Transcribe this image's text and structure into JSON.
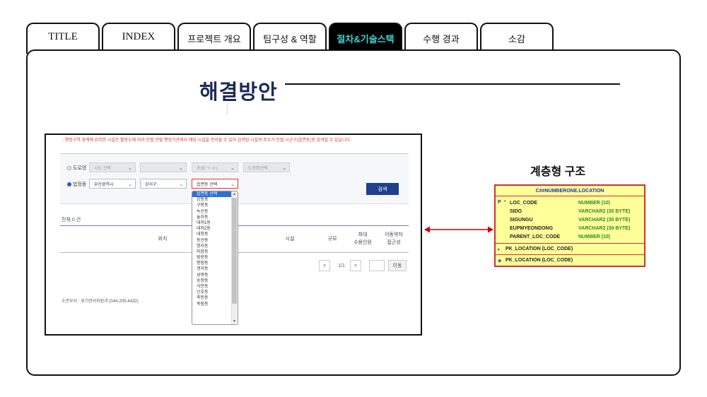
{
  "tabs": [
    {
      "label": "TITLE"
    },
    {
      "label": "INDEX"
    },
    {
      "label": "프로젝트 개요"
    },
    {
      "label": "팀구성 & 역할"
    },
    {
      "label": "절차&기술스택"
    },
    {
      "label": "수행 경과"
    },
    {
      "label": "소감"
    }
  ],
  "section": {
    "heading": "해결방안"
  },
  "screenshot": {
    "notice": "- 행정구역 경계에 위치한 시설은 활용도에 따라 인접 관할 행정기관에서 해당 시설을 관리할 수 있어 검색된 시설의 주소가 인접 시군구(읍면동)로 검색될 수 있습니다.",
    "radio_road": "도로명",
    "radio_legal": "법정동",
    "sel_sido": "시도 선택",
    "sel_sigungu": "",
    "sel_initial": "초성(ㄱ~ㅎ)",
    "sel_roadname": "도로명선택",
    "sel_busan": "부산광역시",
    "sel_gangseo": "강서구",
    "sel_eupmyeondong": "읍면동 선택",
    "search_button": "검색",
    "total_label": "전체",
    "total_count": "0",
    "total_unit": "건",
    "col_location": "위치",
    "col_facility": "시설",
    "col_scale": "규모",
    "col_max_line1": "최대",
    "col_max_line2": "수용인원",
    "col_access_line1": "이동약자",
    "col_access_line2": "접근성",
    "pager_prev": "<",
    "pager_info": "1/1",
    "pager_next": ">",
    "pager_go": "이동",
    "footer": "소관부서 : 위기관리지원과 (044-205-4432)",
    "dropdown_items": [
      "읍면동 선택",
      "강동동",
      "구랑동",
      "녹산동",
      "눌차동",
      "대저1동",
      "대저2동",
      "대항동",
      "동선동",
      "명지동",
      "미음동",
      "범방동",
      "봉림동",
      "생곡동",
      "성북동",
      "송정동",
      "식만동",
      "신호동",
      "죽동동",
      "죽림동"
    ]
  },
  "hierarchy": {
    "title": "계층형 구조",
    "table_name": "C##NUMBERONE.LOCATION",
    "pk_marker": "P",
    "pk_star": "*",
    "columns": [
      {
        "name": "LOC_CODE",
        "type": "NUMBER (10)"
      },
      {
        "name": "SIDO",
        "type": "VARCHAR2 (30 BYTE)"
      },
      {
        "name": "SIGUNGU",
        "type": "VARCHAR2 (30 BYTE)"
      },
      {
        "name": "EUPMYEONDONG",
        "type": "VARCHAR2 (30 BYTE)"
      },
      {
        "name": "PARENT_LOC_CODE",
        "type": "NUMBER (10)"
      }
    ],
    "constraint1": "PK_LOCATION (LOC_CODE)",
    "constraint2": "PK_LOCATION (LOC_CODE)"
  },
  "colors": {
    "active_tab_text": "#3fd4d0",
    "heading": "#1c2a55",
    "arrow": "#cc0000",
    "erd_fill": "#ffff9a"
  }
}
